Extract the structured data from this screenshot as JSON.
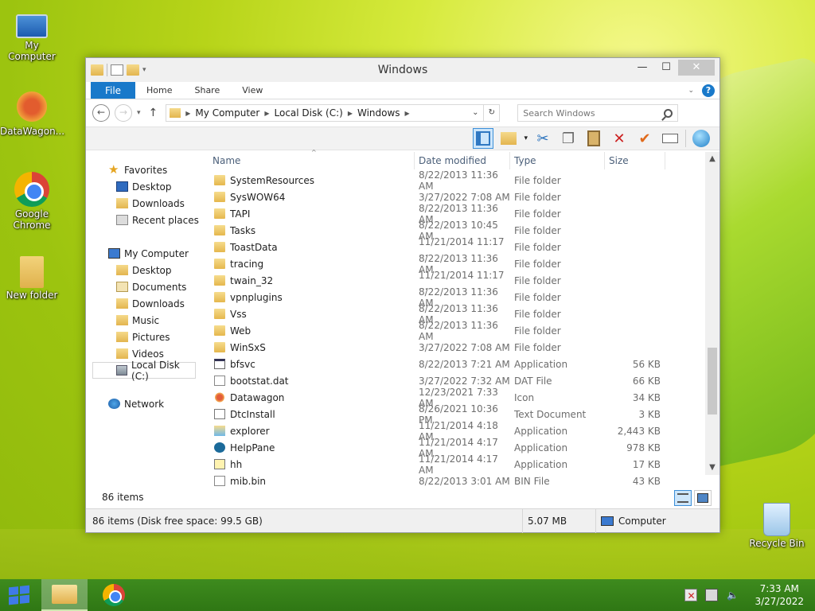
{
  "desktop": {
    "icons": [
      {
        "label": "My Computer"
      },
      {
        "label": "DataWagon..."
      },
      {
        "label": "Google Chrome"
      },
      {
        "label": "New folder"
      },
      {
        "label": "Recycle Bin"
      }
    ]
  },
  "window": {
    "title": "Windows",
    "ribbon": {
      "tabs": [
        "File",
        "Home",
        "Share",
        "View"
      ]
    },
    "address": {
      "crumbs": [
        "My Computer",
        "Local Disk (C:)",
        "Windows"
      ]
    },
    "search": {
      "placeholder": "Search Windows"
    },
    "columns": {
      "name": "Name",
      "date": "Date modified",
      "type": "Type",
      "size": "Size"
    },
    "nav": {
      "favorites": "Favorites",
      "fav_items": [
        "Desktop",
        "Downloads",
        "Recent places"
      ],
      "computer": "My Computer",
      "comp_items": [
        "Desktop",
        "Documents",
        "Downloads",
        "Music",
        "Pictures",
        "Videos",
        "Local Disk (C:)"
      ],
      "network": "Network"
    },
    "files": [
      {
        "name": "SystemResources",
        "date": "8/22/2013 11:36 AM",
        "type": "File folder",
        "size": "",
        "icon": "folder"
      },
      {
        "name": "SysWOW64",
        "date": "3/27/2022 7:08 AM",
        "type": "File folder",
        "size": "",
        "icon": "folder"
      },
      {
        "name": "TAPI",
        "date": "8/22/2013 11:36 AM",
        "type": "File folder",
        "size": "",
        "icon": "folder"
      },
      {
        "name": "Tasks",
        "date": "8/22/2013 10:45 AM",
        "type": "File folder",
        "size": "",
        "icon": "folder"
      },
      {
        "name": "ToastData",
        "date": "11/21/2014 11:17 ...",
        "type": "File folder",
        "size": "",
        "icon": "folder"
      },
      {
        "name": "tracing",
        "date": "8/22/2013 11:36 AM",
        "type": "File folder",
        "size": "",
        "icon": "folder"
      },
      {
        "name": "twain_32",
        "date": "11/21/2014 11:17 ...",
        "type": "File folder",
        "size": "",
        "icon": "folder"
      },
      {
        "name": "vpnplugins",
        "date": "8/22/2013 11:36 AM",
        "type": "File folder",
        "size": "",
        "icon": "folder"
      },
      {
        "name": "Vss",
        "date": "8/22/2013 11:36 AM",
        "type": "File folder",
        "size": "",
        "icon": "folder"
      },
      {
        "name": "Web",
        "date": "8/22/2013 11:36 AM",
        "type": "File folder",
        "size": "",
        "icon": "folder"
      },
      {
        "name": "WinSxS",
        "date": "3/27/2022 7:08 AM",
        "type": "File folder",
        "size": "",
        "icon": "folder"
      },
      {
        "name": "bfsvc",
        "date": "8/22/2013 7:21 AM",
        "type": "Application",
        "size": "56 KB",
        "icon": "app"
      },
      {
        "name": "bootstat.dat",
        "date": "3/27/2022 7:32 AM",
        "type": "DAT File",
        "size": "66 KB",
        "icon": "dat"
      },
      {
        "name": "Datawagon",
        "date": "12/23/2021 7:33 AM",
        "type": "Icon",
        "size": "34 KB",
        "icon": "ico"
      },
      {
        "name": "DtcInstall",
        "date": "8/26/2021 10:36 PM",
        "type": "Text Document",
        "size": "3 KB",
        "icon": "txt"
      },
      {
        "name": "explorer",
        "date": "11/21/2014 4:18 AM",
        "type": "Application",
        "size": "2,443 KB",
        "icon": "exp"
      },
      {
        "name": "HelpPane",
        "date": "11/21/2014 4:17 AM",
        "type": "Application",
        "size": "978 KB",
        "icon": "help"
      },
      {
        "name": "hh",
        "date": "11/21/2014 4:17 AM",
        "type": "Application",
        "size": "17 KB",
        "icon": "hh"
      },
      {
        "name": "mib.bin",
        "date": "8/22/2013 3:01 AM",
        "type": "BIN File",
        "size": "43 KB",
        "icon": "bin"
      }
    ],
    "items_count": "86 items",
    "status": {
      "left": "86 items (Disk free space: 99.5 GB)",
      "size": "5.07 MB",
      "location": "Computer"
    }
  },
  "taskbar": {
    "time": "7:33 AM",
    "date": "3/27/2022"
  }
}
